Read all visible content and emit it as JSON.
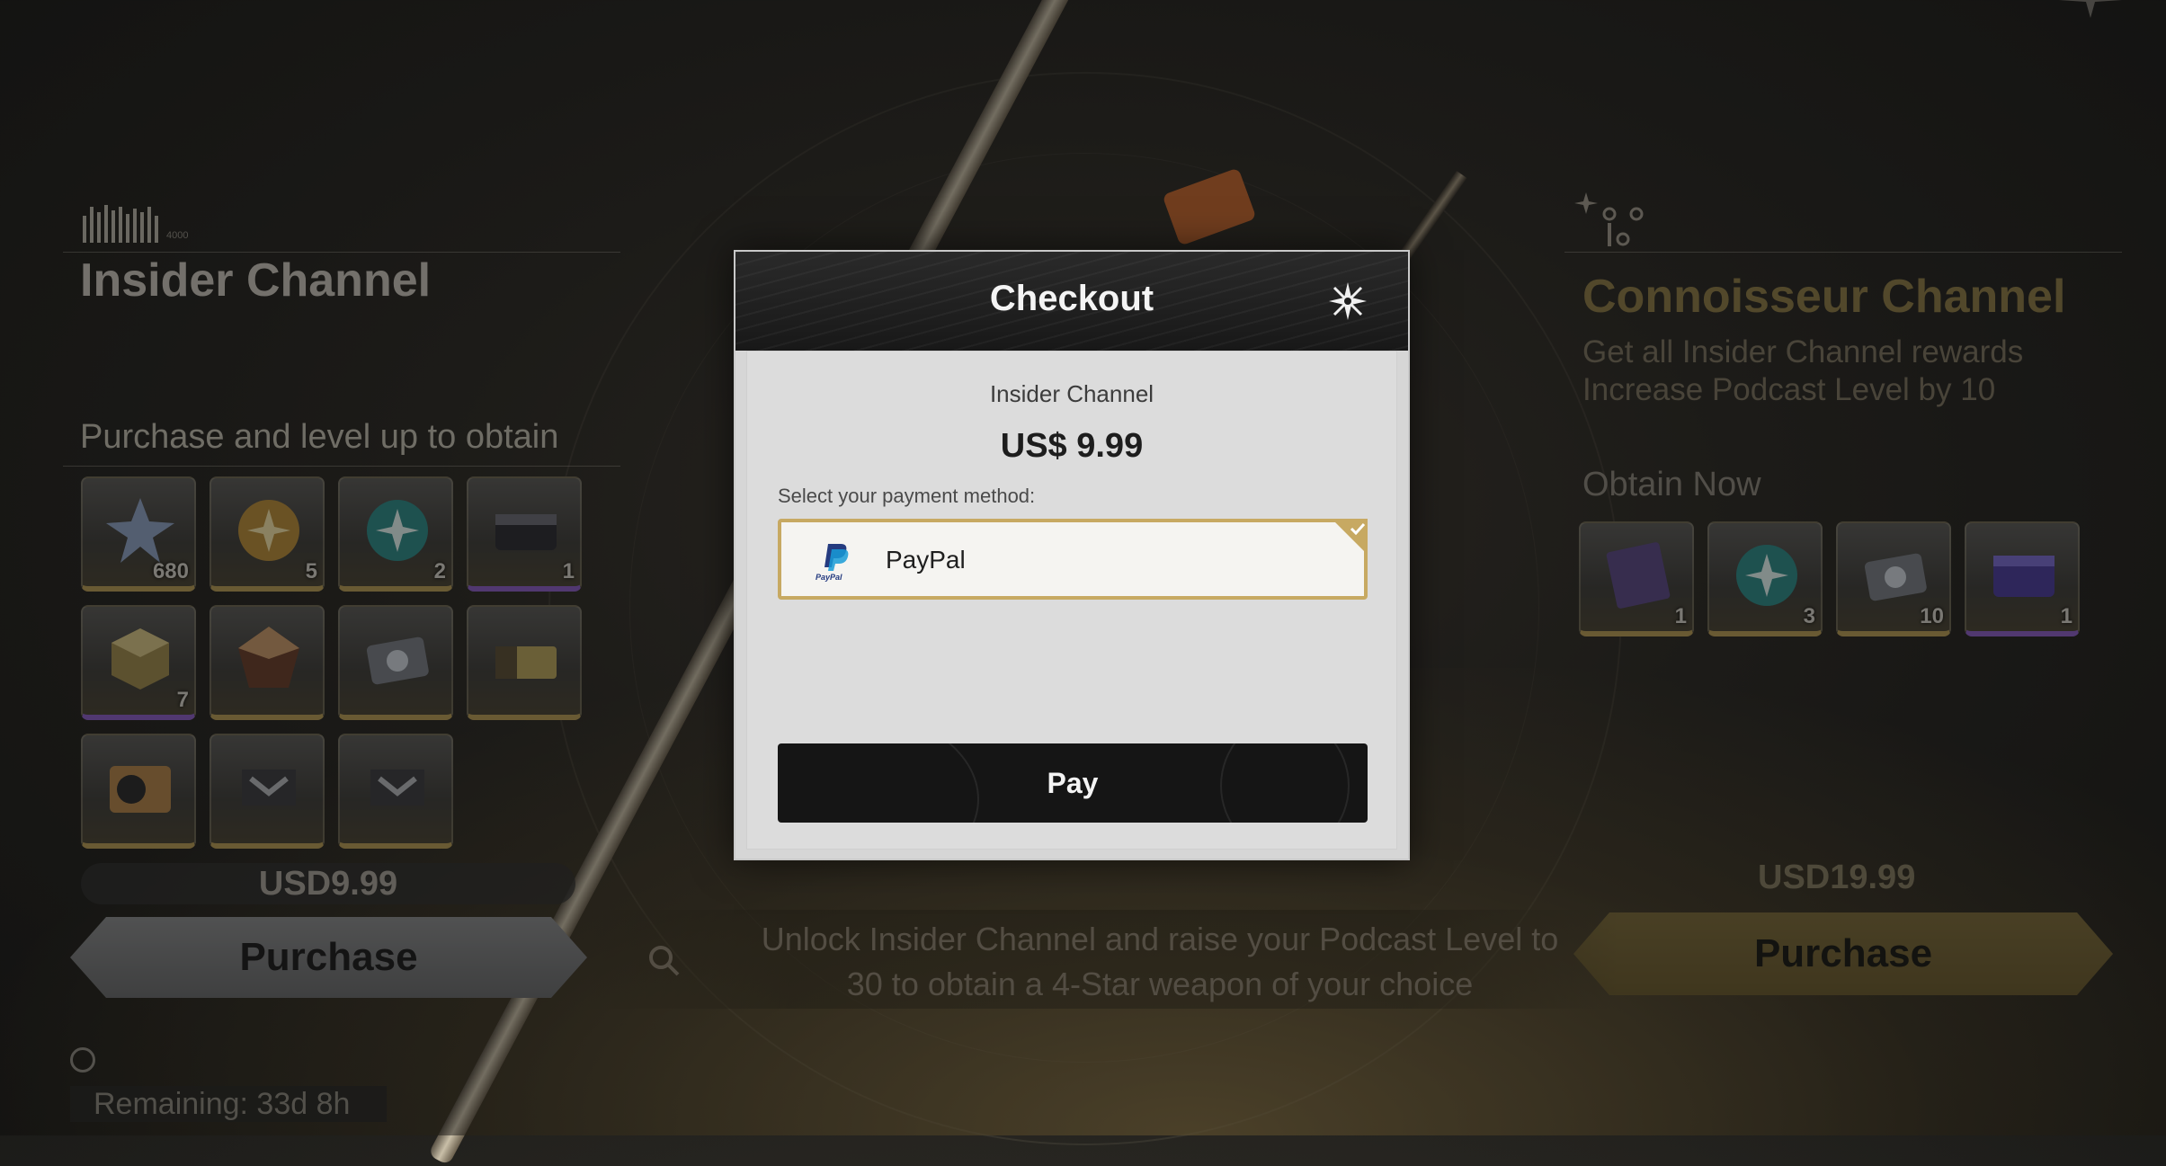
{
  "left": {
    "wave_number": "4000",
    "title": "Insider Channel",
    "section_title": "Purchase and level up to obtain",
    "items": [
      {
        "name": "star-crystal",
        "count": "680",
        "rarity": "gold"
      },
      {
        "name": "gold-orb",
        "count": "5",
        "rarity": "gold"
      },
      {
        "name": "teal-orb",
        "count": "2",
        "rarity": "gold"
      },
      {
        "name": "supply-case",
        "count": "1",
        "rarity": "purple"
      },
      {
        "name": "gold-cube",
        "count": "7",
        "rarity": "purple"
      },
      {
        "name": "bronze-gem",
        "count": "",
        "rarity": "gold"
      },
      {
        "name": "device-box",
        "count": "",
        "rarity": "gold"
      },
      {
        "name": "yellow-crate",
        "count": "",
        "rarity": "gold"
      },
      {
        "name": "speaker-crate",
        "count": "",
        "rarity": "gold"
      },
      {
        "name": "echo-box-1",
        "count": "",
        "rarity": "gold"
      },
      {
        "name": "echo-box-2",
        "count": "",
        "rarity": "gold"
      }
    ],
    "price": "USD9.99",
    "purchase_label": "Purchase",
    "remaining": "Remaining: 33d 8h"
  },
  "right": {
    "title": "Connoisseur Channel",
    "line1": "Get all Insider Channel rewards",
    "line2": "Increase Podcast Level by 10",
    "section_title": "Obtain Now",
    "items": [
      {
        "name": "purple-card",
        "count": "1",
        "rarity": "gold"
      },
      {
        "name": "teal-orb",
        "count": "3",
        "rarity": "gold"
      },
      {
        "name": "device-box",
        "count": "10",
        "rarity": "gold"
      },
      {
        "name": "purple-case",
        "count": "1",
        "rarity": "purple"
      }
    ],
    "price": "USD19.99",
    "purchase_label": "Purchase"
  },
  "hint": {
    "line1": "Unlock Insider Channel and raise your Podcast Level to",
    "line2": "30 to obtain a 4-Star weapon of your choice"
  },
  "checkout": {
    "title": "Checkout",
    "product": "Insider Channel",
    "price": "US$ 9.99",
    "payment_label": "Select your payment method:",
    "method": "PayPal",
    "paypal_logo_text": "PayPal",
    "pay_label": "Pay",
    "accent": "#c7a962"
  }
}
